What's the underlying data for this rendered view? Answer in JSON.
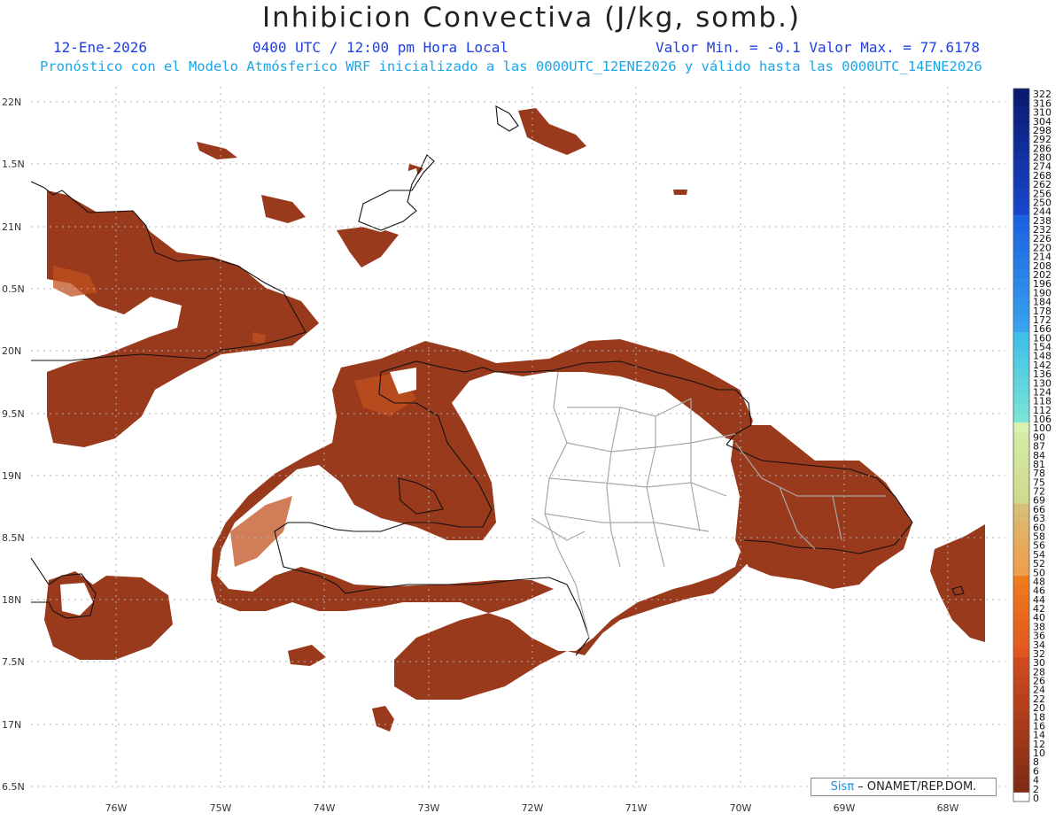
{
  "header": {
    "title": "Inhibicion Convectiva (J/kg, somb.)",
    "date": "12-Ene-2026",
    "time": "0400 UTC / 12:00 pm Hora Local",
    "range": "Valor Min. = -0.1  Valor Max. = 77.6178",
    "model": "Pronóstico con el Modelo Atmósferico WRF inicializado a las 0000UTC_12ENE2026 y válido hasta las  0000UTC_14ENE2026"
  },
  "axes": {
    "lat_labels": [
      "22N",
      "1.5N",
      "21N",
      "0.5N",
      "20N",
      "9.5N",
      "19N",
      "8.5N",
      "18N",
      "7.5N",
      "17N",
      "6.5N"
    ],
    "lon_labels": [
      "76W",
      "75W",
      "74W",
      "73W",
      "72W",
      "71W",
      "70W",
      "69W",
      "68W"
    ]
  },
  "colorbar": {
    "labels": [
      "322",
      "316",
      "310",
      "304",
      "298",
      "292",
      "286",
      "280",
      "274",
      "268",
      "262",
      "256",
      "250",
      "244",
      "238",
      "232",
      "226",
      "220",
      "214",
      "208",
      "202",
      "196",
      "190",
      "184",
      "178",
      "172",
      "166",
      "160",
      "154",
      "148",
      "142",
      "136",
      "130",
      "124",
      "118",
      "112",
      "106",
      "100",
      "90",
      "87",
      "84",
      "81",
      "78",
      "75",
      "72",
      "69",
      "66",
      "63",
      "60",
      "58",
      "56",
      "54",
      "52",
      "50",
      "48",
      "46",
      "44",
      "42",
      "40",
      "38",
      "36",
      "34",
      "32",
      "30",
      "28",
      "26",
      "24",
      "22",
      "20",
      "18",
      "16",
      "14",
      "12",
      "10",
      "8",
      "6",
      "4",
      "2",
      "0"
    ]
  },
  "colors": {
    "field_main": "#9a3a1c",
    "field_dark": "#8a2f17",
    "field_light": "#c2511f",
    "coast": "#111111",
    "border": "#a8a8a8",
    "grid": "#b0b0b0"
  },
  "credit": {
    "brand": "Sis",
    "pi": "π",
    "org": "– ONAMET/REP.DOM."
  }
}
